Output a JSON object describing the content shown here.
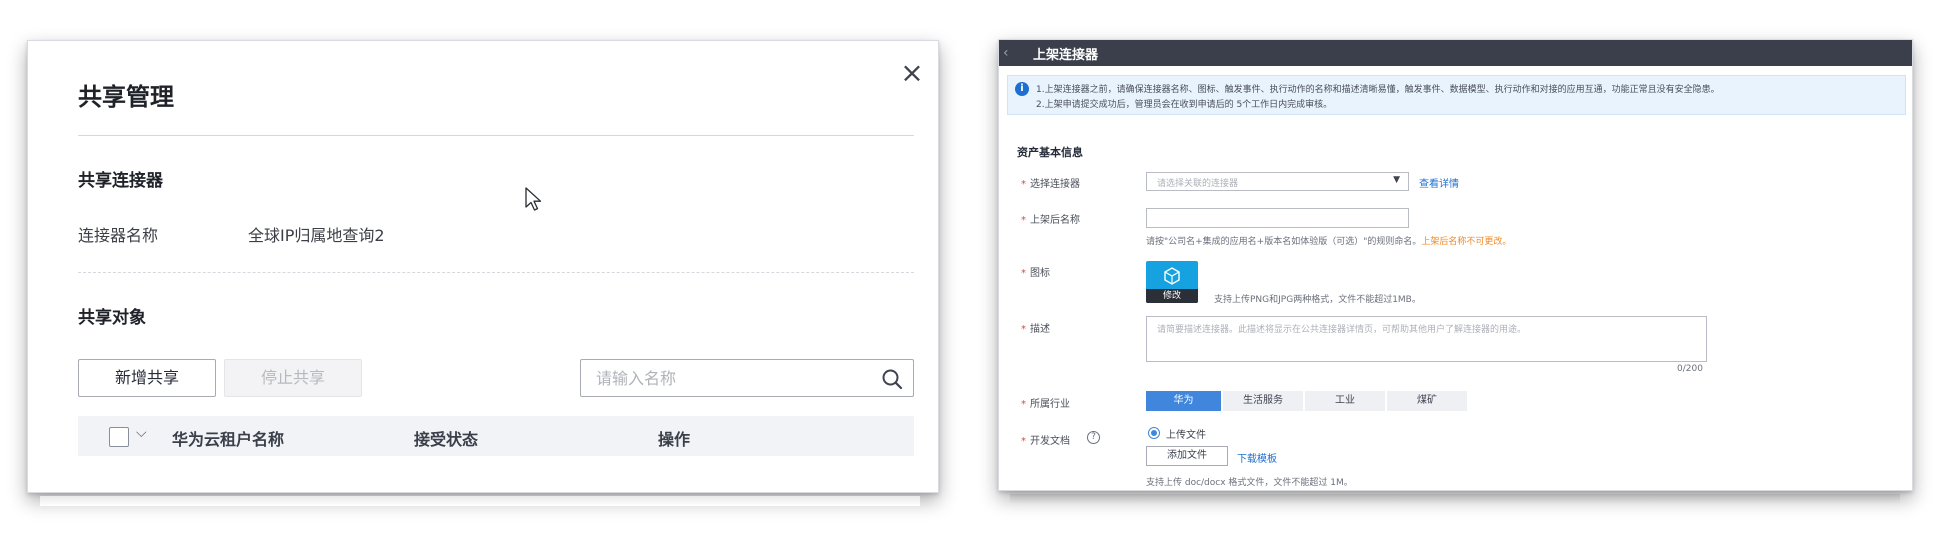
{
  "share_dialog": {
    "title": "共享管理",
    "close_label": "×",
    "connector_section": "共享连接器",
    "connector_name_label": "连接器名称",
    "connector_name_value": "全球IP归属地查询2",
    "target_section": "共享对象",
    "add_share_label": "新增共享",
    "stop_share_label": "停止共享",
    "search_placeholder": "请输入名称",
    "columns": [
      "华为云租户名称",
      "接受状态",
      "操作"
    ]
  },
  "publish_panel": {
    "title": "上架连接器",
    "notice_line1": "1.上架连接器之前，请确保连接器名称、图标、触发事件、执行动作的名称和描述清晰易懂，触发事件、数据模型、执行动作和对接的应用互通，功能正常且没有安全隐患。",
    "notice_line2": "2.上架申请提交成功后，管理员会在收到申请后的 5个工作日内完成审核。",
    "section_title": "资产基本信息",
    "select_connector_label": "选择连接器",
    "select_connector_placeholder": "请选择关联的连接器",
    "view_details_link": "查看详情",
    "listing_name_label": "上架后名称",
    "listing_name_hint": "请按\"公司名+集成的应用名+版本名如体验版（可选）\"的规则命名。",
    "listing_name_warning": "上架后名称不可更改。",
    "icon_label": "图标",
    "icon_edit_label": "修改",
    "icon_hint": "支持上传PNG和JPG两种格式，文件不能超过1MB。",
    "description_label": "描述",
    "description_placeholder": "请简要描述连接器。此描述将显示在公共连接器详情页，可帮助其他用户了解连接器的用途。",
    "description_counter": "0/200",
    "industry_label": "所属行业",
    "industries": [
      "华为",
      "生活服务",
      "工业",
      "煤矿"
    ],
    "industry_selected": "华为",
    "dev_doc_label": "开发文档",
    "radio_upload_label": "上传文件",
    "add_file_label": "添加文件",
    "download_template_link": "下载模板",
    "file_note": "支持上传 doc/docx 格式文件，文件不能超过 1M。",
    "accent_color": "#3f86dc",
    "header_color": "#3a3f4b"
  }
}
